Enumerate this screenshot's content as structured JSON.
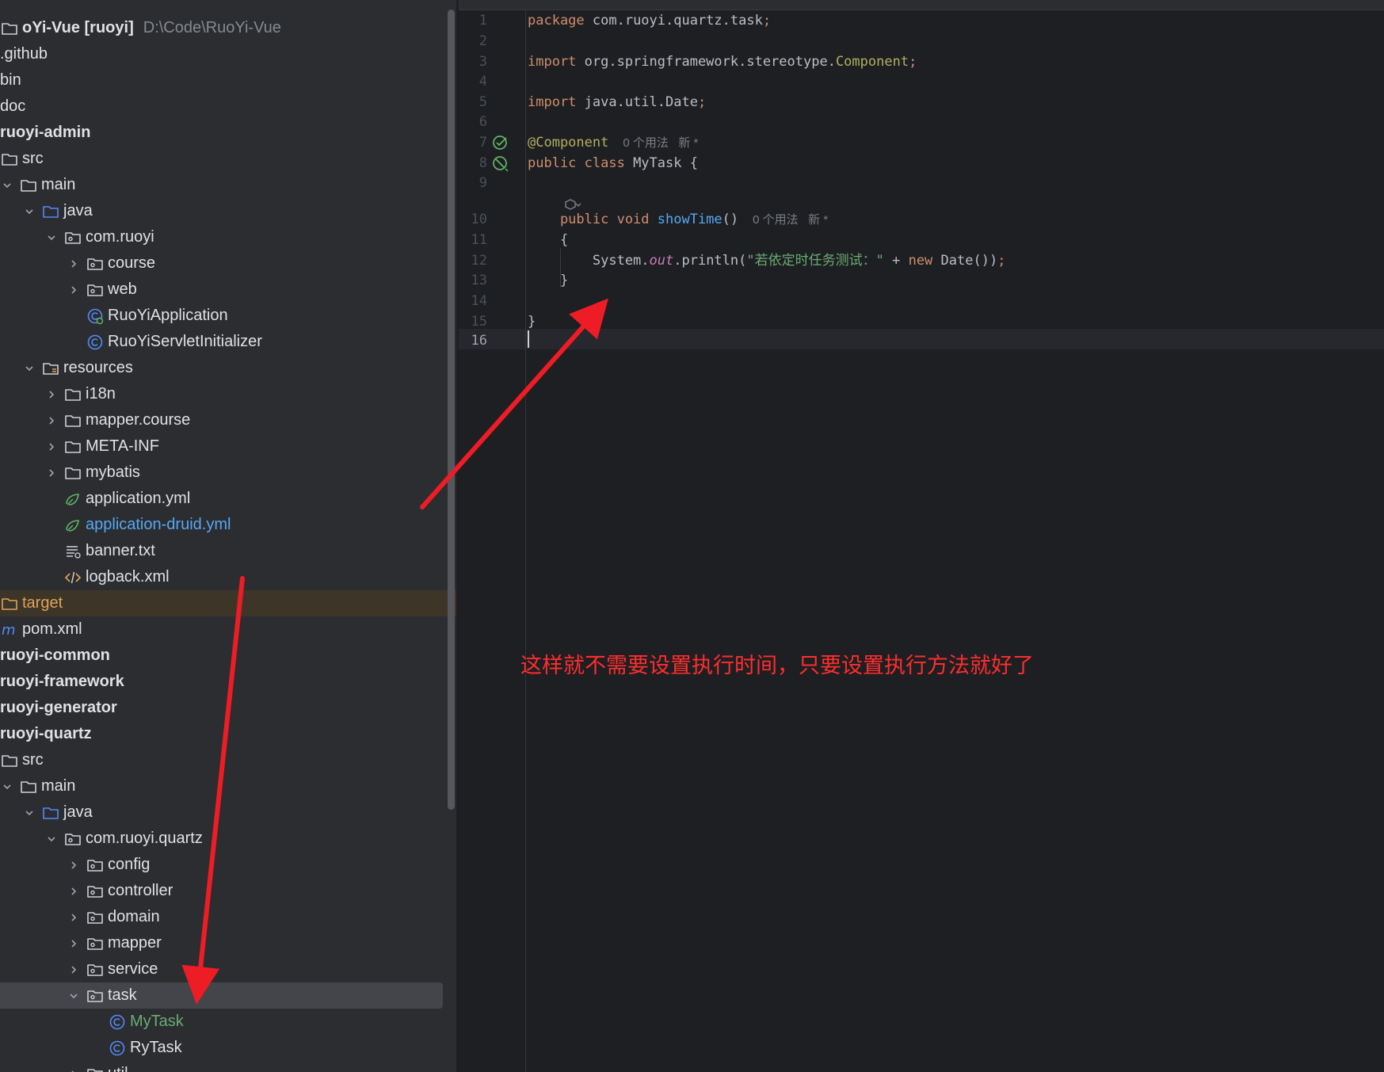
{
  "project_tree": {
    "rows": [
      {
        "label": "oYi-Vue [ruoyi]",
        "suffix": "D:\\Code\\RuoYi-Vue",
        "bold": true,
        "indent": 0,
        "chevron": "none",
        "icon": "module-folder-icon",
        "color": "#dfe1e5"
      },
      {
        "label": ".github",
        "indent": 0,
        "chevron": "none",
        "icon": "none",
        "color": "#dfe1e5"
      },
      {
        "label": "bin",
        "indent": 0,
        "chevron": "none",
        "icon": "none",
        "color": "#dfe1e5"
      },
      {
        "label": "doc",
        "indent": 0,
        "chevron": "none",
        "icon": "none",
        "color": "#dfe1e5"
      },
      {
        "label": "ruoyi-admin",
        "bold": true,
        "indent": 0,
        "chevron": "none",
        "icon": "none",
        "color": "#dfe1e5"
      },
      {
        "label": "src",
        "indent": 0,
        "chevron": "none",
        "icon": "folder-icon",
        "color": "#dfe1e5"
      },
      {
        "label": "main",
        "indent": 0,
        "chevron": "down",
        "icon": "folder-icon",
        "color": "#dfe1e5"
      },
      {
        "label": "java",
        "indent": 1,
        "chevron": "down",
        "icon": "source-folder-icon",
        "color": "#dfe1e5"
      },
      {
        "label": "com.ruoyi",
        "indent": 2,
        "chevron": "down",
        "icon": "package-icon",
        "color": "#dfe1e5"
      },
      {
        "label": "course",
        "indent": 3,
        "chevron": "right",
        "icon": "package-icon",
        "color": "#dfe1e5"
      },
      {
        "label": "web",
        "indent": 3,
        "chevron": "right",
        "icon": "package-icon",
        "color": "#dfe1e5"
      },
      {
        "label": "RuoYiApplication",
        "indent": 3,
        "chevron": "none",
        "icon": "spring-boot-class-icon",
        "color": "#dfe1e5"
      },
      {
        "label": "RuoYiServletInitializer",
        "indent": 3,
        "chevron": "none",
        "icon": "class-icon",
        "color": "#dfe1e5"
      },
      {
        "label": "resources",
        "indent": 1,
        "chevron": "down",
        "icon": "resources-folder-icon",
        "color": "#dfe1e5"
      },
      {
        "label": "i18n",
        "indent": 2,
        "chevron": "right",
        "icon": "folder-icon",
        "color": "#dfe1e5"
      },
      {
        "label": "mapper.course",
        "indent": 2,
        "chevron": "right",
        "icon": "folder-icon",
        "color": "#dfe1e5"
      },
      {
        "label": "META-INF",
        "indent": 2,
        "chevron": "right",
        "icon": "folder-icon",
        "color": "#dfe1e5"
      },
      {
        "label": "mybatis",
        "indent": 2,
        "chevron": "right",
        "icon": "folder-icon",
        "color": "#dfe1e5"
      },
      {
        "label": "application.yml",
        "indent": 2,
        "chevron": "none",
        "icon": "spring-yml-icon",
        "color": "#dfe1e5"
      },
      {
        "label": "application-druid.yml",
        "indent": 2,
        "chevron": "none",
        "icon": "spring-yml-icon",
        "color": "#56a8f5"
      },
      {
        "label": "banner.txt",
        "indent": 2,
        "chevron": "none",
        "icon": "text-file-icon",
        "color": "#dfe1e5"
      },
      {
        "label": "logback.xml",
        "indent": 2,
        "chevron": "none",
        "icon": "xml-file-icon",
        "color": "#dfe1e5"
      },
      {
        "label": "target",
        "indent": 0,
        "chevron": "none",
        "icon": "excluded-folder-icon",
        "color": "#e0a35a",
        "state": "excluded"
      },
      {
        "label": "pom.xml",
        "indent": 0,
        "chevron": "none",
        "icon": "maven-icon",
        "color": "#dfe1e5"
      },
      {
        "label": "ruoyi-common",
        "bold": true,
        "indent": 0,
        "chevron": "none",
        "icon": "none",
        "color": "#dfe1e5"
      },
      {
        "label": "ruoyi-framework",
        "bold": true,
        "indent": 0,
        "chevron": "none",
        "icon": "none",
        "color": "#dfe1e5"
      },
      {
        "label": "ruoyi-generator",
        "bold": true,
        "indent": 0,
        "chevron": "none",
        "icon": "none",
        "color": "#dfe1e5"
      },
      {
        "label": "ruoyi-quartz",
        "bold": true,
        "indent": 0,
        "chevron": "none",
        "icon": "none",
        "color": "#dfe1e5"
      },
      {
        "label": "src",
        "indent": 0,
        "chevron": "none",
        "icon": "folder-icon",
        "color": "#dfe1e5"
      },
      {
        "label": "main",
        "indent": 0,
        "chevron": "down",
        "icon": "folder-icon",
        "color": "#dfe1e5"
      },
      {
        "label": "java",
        "indent": 1,
        "chevron": "down",
        "icon": "source-folder-icon",
        "color": "#dfe1e5"
      },
      {
        "label": "com.ruoyi.quartz",
        "indent": 2,
        "chevron": "down",
        "icon": "package-icon",
        "color": "#dfe1e5"
      },
      {
        "label": "config",
        "indent": 3,
        "chevron": "right",
        "icon": "package-icon",
        "color": "#dfe1e5"
      },
      {
        "label": "controller",
        "indent": 3,
        "chevron": "right",
        "icon": "package-icon",
        "color": "#dfe1e5"
      },
      {
        "label": "domain",
        "indent": 3,
        "chevron": "right",
        "icon": "package-icon",
        "color": "#dfe1e5"
      },
      {
        "label": "mapper",
        "indent": 3,
        "chevron": "right",
        "icon": "package-icon",
        "color": "#dfe1e5"
      },
      {
        "label": "service",
        "indent": 3,
        "chevron": "right",
        "icon": "package-icon",
        "color": "#dfe1e5"
      },
      {
        "label": "task",
        "indent": 3,
        "chevron": "down",
        "icon": "package-icon",
        "color": "#dfe1e5",
        "state": "selected"
      },
      {
        "label": "MyTask",
        "indent": 4,
        "chevron": "none",
        "icon": "class-icon",
        "color": "#6aab73"
      },
      {
        "label": "RyTask",
        "indent": 4,
        "chevron": "none",
        "icon": "class-icon",
        "color": "#dfe1e5"
      },
      {
        "label": "util",
        "indent": 3,
        "chevron": "right",
        "icon": "package-icon",
        "color": "#dfe1e5"
      }
    ]
  },
  "editor": {
    "lines": [
      {
        "n": "1",
        "tokens": [
          {
            "t": "package ",
            "c": "kw"
          },
          {
            "t": "com.ruoyi.quartz.task",
            "c": ""
          },
          {
            "t": ";",
            "c": "kw"
          }
        ]
      },
      {
        "n": "2",
        "tokens": []
      },
      {
        "n": "3",
        "tokens": [
          {
            "t": "import ",
            "c": "kw"
          },
          {
            "t": "org.springframework.stereotype.",
            "c": ""
          },
          {
            "t": "Component",
            "c": "ann"
          },
          {
            "t": ";",
            "c": "kw"
          }
        ]
      },
      {
        "n": "4",
        "tokens": []
      },
      {
        "n": "5",
        "tokens": [
          {
            "t": "import ",
            "c": "kw"
          },
          {
            "t": "java.util.Date",
            "c": ""
          },
          {
            "t": ";",
            "c": "kw"
          }
        ]
      },
      {
        "n": "6",
        "tokens": []
      },
      {
        "n": "7",
        "tokens": [
          {
            "t": "@Component",
            "c": "ann"
          }
        ],
        "hint": "0 个用法   新 *",
        "gutter": "spring-bean-icon"
      },
      {
        "n": "8",
        "tokens": [
          {
            "t": "public class ",
            "c": "kw"
          },
          {
            "t": "MyTask ",
            "c": ""
          },
          {
            "t": "{",
            "c": ""
          }
        ],
        "gutter": "no-bean-icon"
      },
      {
        "n": "9",
        "tokens": []
      },
      {
        "n": "",
        "tokens": [],
        "inlay": "ai-assistant-icon"
      },
      {
        "n": "10",
        "tokens": [
          {
            "t": "    public void ",
            "c": "kw"
          },
          {
            "t": "showTime",
            "c": "fn"
          },
          {
            "t": "()",
            "c": ""
          }
        ],
        "hint": "0 个用法   新 *"
      },
      {
        "n": "11",
        "tokens": [
          {
            "t": "    {",
            "c": ""
          }
        ]
      },
      {
        "n": "12",
        "tokens": [
          {
            "t": "        System.",
            "c": ""
          },
          {
            "t": "out",
            "c": "fld"
          },
          {
            "t": ".println(",
            "c": ""
          },
          {
            "t": "\"若依定时任务测试：\"",
            "c": "str"
          },
          {
            "t": " + ",
            "c": ""
          },
          {
            "t": "new ",
            "c": "kw"
          },
          {
            "t": "Date",
            "c": ""
          },
          {
            "t": "())",
            "c": ""
          },
          {
            "t": ";",
            "c": "kw"
          }
        ]
      },
      {
        "n": "13",
        "tokens": [
          {
            "t": "    }",
            "c": ""
          }
        ]
      },
      {
        "n": "14",
        "tokens": []
      },
      {
        "n": "15",
        "tokens": [
          {
            "t": "}",
            "c": ""
          }
        ]
      },
      {
        "n": "16",
        "tokens": [],
        "active": true
      }
    ]
  },
  "annotation": {
    "note": "这样就不需要设置执行时间，只要设置执行方法就好了",
    "color": "#ff2d2d"
  }
}
